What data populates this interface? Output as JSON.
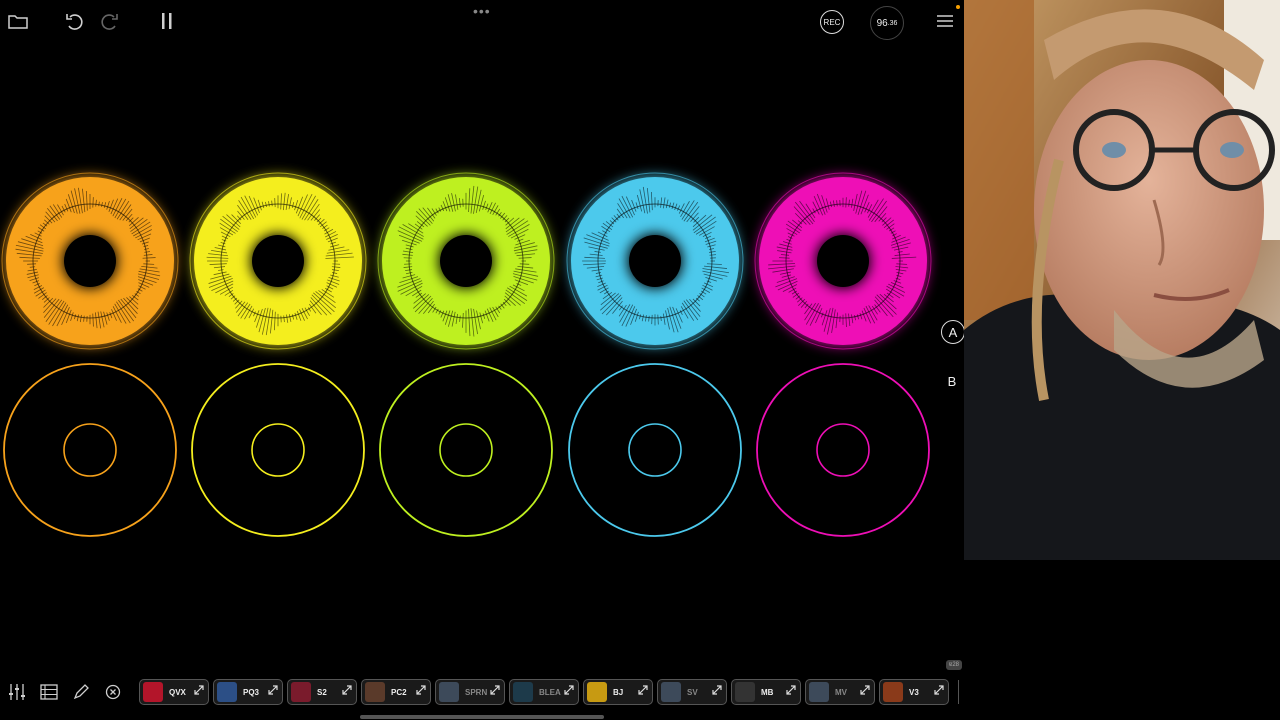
{
  "top": {
    "rec_label": "REC",
    "tempo_main": "96",
    "tempo_frac": ".36",
    "more_dots": "•••"
  },
  "scenes": {
    "a_label": "A",
    "b_label": "B"
  },
  "colors": {
    "orange": "#f7a21b",
    "yellow": "#f4ee1e",
    "green": "#bef020",
    "cyan": "#4cc9ec",
    "magenta": "#ee0fb6"
  },
  "loops_top": [
    {
      "color": "orange",
      "state": "playing"
    },
    {
      "color": "yellow",
      "state": "playing"
    },
    {
      "color": "green",
      "state": "playing"
    },
    {
      "color": "cyan",
      "state": "playing"
    },
    {
      "color": "magenta",
      "state": "playing"
    }
  ],
  "loops_bottom": [
    {
      "color": "orange",
      "state": "empty"
    },
    {
      "color": "yellow",
      "state": "empty"
    },
    {
      "color": "green",
      "state": "empty"
    },
    {
      "color": "cyan",
      "state": "empty"
    },
    {
      "color": "magenta",
      "state": "empty"
    }
  ],
  "plugins": [
    {
      "label": "QVX",
      "thumb": "#b3152a",
      "dim": false
    },
    {
      "label": "PQ3",
      "thumb": "#2c4f86",
      "dim": false
    },
    {
      "label": "S2",
      "thumb": "#7a1b2c",
      "dim": false
    },
    {
      "label": "PC2",
      "thumb": "#5a3a2a",
      "dim": false
    },
    {
      "label": "SPRN",
      "thumb": "#3d4a5a",
      "dim": true
    },
    {
      "label": "BLEA",
      "thumb": "#1d3a4a",
      "dim": true
    },
    {
      "label": "BJ",
      "thumb": "#c79a12",
      "dim": false
    },
    {
      "label": "SV",
      "thumb": "#3d4a5a",
      "dim": true
    },
    {
      "label": "MB",
      "thumb": "#333333",
      "dim": false
    },
    {
      "label": "MV",
      "thumb": "#3d4a5a",
      "dim": true
    },
    {
      "label": "V3",
      "thumb": "#8a3a1a",
      "dim": false
    }
  ],
  "corner_badge": "ɐ28"
}
